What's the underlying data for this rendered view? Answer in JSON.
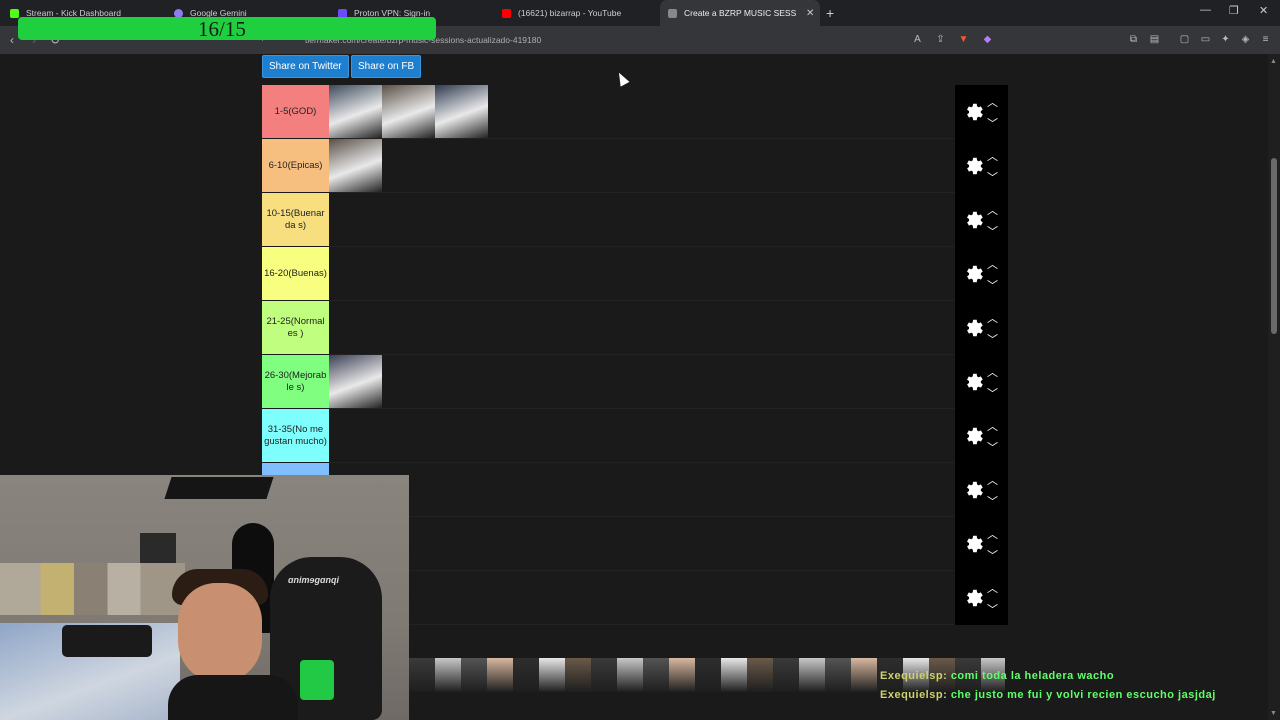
{
  "tabs": [
    {
      "label": "Stream - Kick Dashboard",
      "color": "#53fc18"
    },
    {
      "label": "Google Gemini",
      "color": "#8e7cf2"
    },
    {
      "label": "Proton VPN: Sign-in",
      "color": "#6d4aff"
    },
    {
      "label": "(16621) bizarrap - YouTube",
      "color": "#ff0000"
    },
    {
      "label": "Create a BZRP MUSIC SESSIONS",
      "color": "#888888",
      "active": true
    }
  ],
  "overlay": {
    "text": "16/15",
    "color": "#1fcf3f"
  },
  "address_bar": {
    "url": "tiermaker.com/create/bzrp-music-sessions-actualizado-419180"
  },
  "share": {
    "twitter": "Share on Twitter",
    "facebook": "Share on FB"
  },
  "tiers": [
    {
      "label": "1-5(GOD)",
      "color": "#f47f7f",
      "items": 3
    },
    {
      "label": "6-10(Epicas)",
      "color": "#f6bf80",
      "items": 1
    },
    {
      "label": "10-15(Buenarda s)",
      "color": "#f7df80",
      "items": 0
    },
    {
      "label": "16-20(Buenas)",
      "color": "#f8fe7f",
      "items": 0
    },
    {
      "label": "21-25(Normales )",
      "color": "#bffe7e",
      "items": 0
    },
    {
      "label": "26-30(Mejorable s)",
      "color": "#7ffe7f",
      "items": 1
    },
    {
      "label": "31-35(No me gustan mucho)",
      "color": "#7ffefe",
      "items": 0
    },
    {
      "label": "",
      "color": "#7fbfff",
      "items": 0
    },
    {
      "label": "",
      "color": "#7f7fff",
      "items": 0
    },
    {
      "label": "",
      "color": "#ff7ffe",
      "items": 1
    }
  ],
  "chat": [
    {
      "user": "Exequielsp:",
      "message": "comi toda la heladera wacho"
    },
    {
      "user": "Exequielsp:",
      "message": "che justo me fui y volvi recien escucho jasjdaj"
    }
  ]
}
